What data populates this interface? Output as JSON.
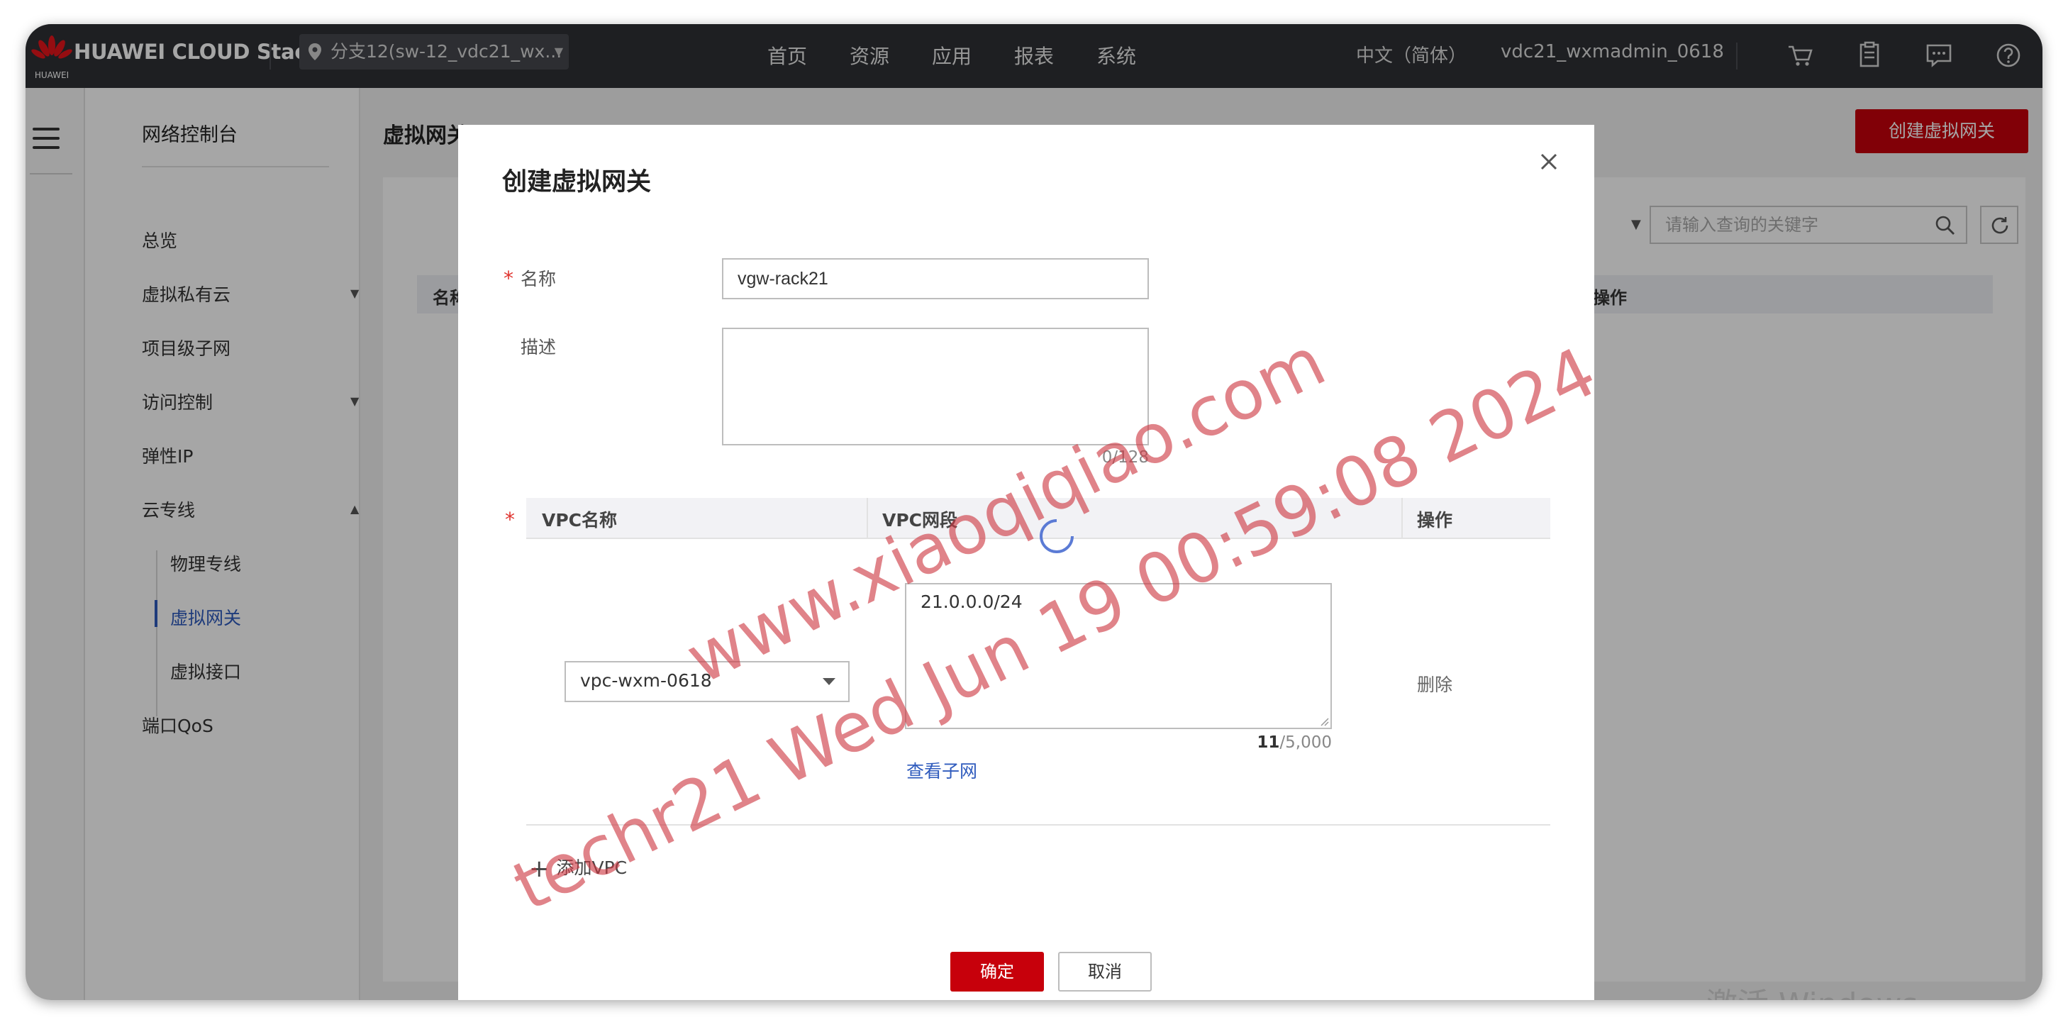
{
  "topbar": {
    "brand": "HUAWEI CLOUD Stack",
    "logo_text": "HUAWEI",
    "region": "分支12(sw-12_vdc21_wx...",
    "nav": [
      "首页",
      "资源",
      "应用",
      "报表",
      "系统"
    ],
    "language": "中文（简体）",
    "user": "vdc21_wxmadmin_0618",
    "icons": [
      "cart-icon",
      "clipboard-icon",
      "message-icon",
      "help-icon"
    ]
  },
  "sidebar": {
    "title": "网络控制台",
    "items": [
      {
        "label": "总览"
      },
      {
        "label": "虚拟私有云"
      },
      {
        "label": "项目级子网"
      },
      {
        "label": "访问控制"
      },
      {
        "label": "弹性IP"
      },
      {
        "label": "云专线"
      },
      {
        "label": "端口QoS"
      }
    ],
    "subitems": [
      {
        "label": "物理专线"
      },
      {
        "label": "虚拟网关"
      },
      {
        "label": "虚拟接口"
      }
    ],
    "active": "虚拟网关"
  },
  "main": {
    "page_title": "虚拟网关",
    "create_button": "创建虚拟网关",
    "search_placeholder": "请输入查询的关键字",
    "table_headers": [
      "名称",
      "操作"
    ]
  },
  "dialog": {
    "title": "创建虚拟网关",
    "name_label": "名称",
    "name_value": "vgw-rack21",
    "desc_label": "描述",
    "desc_counter": "0/128",
    "vpc_headers": [
      "VPC名称",
      "VPC网段",
      "操作"
    ],
    "vpc_select": "vpc-wxm-0618",
    "vpc_cidr": "21.0.0.0/24",
    "cidr_count_used": "11",
    "cidr_count_max": "/5,000",
    "view_subnet": "查看子网",
    "delete": "删除",
    "add_vpc": "添加VPC",
    "ok": "确定",
    "cancel": "取消"
  },
  "watermark": {
    "line1": "www.xiaoqiqiao.com",
    "line2": "techr21 Wed Jun 19 00:59:08 2024",
    "color": "#cd3741"
  },
  "os_watermark": "激活 Windows",
  "colors": {
    "accent": "#c7000b",
    "link": "#2f5bbd",
    "topbar": "#2e3035"
  }
}
